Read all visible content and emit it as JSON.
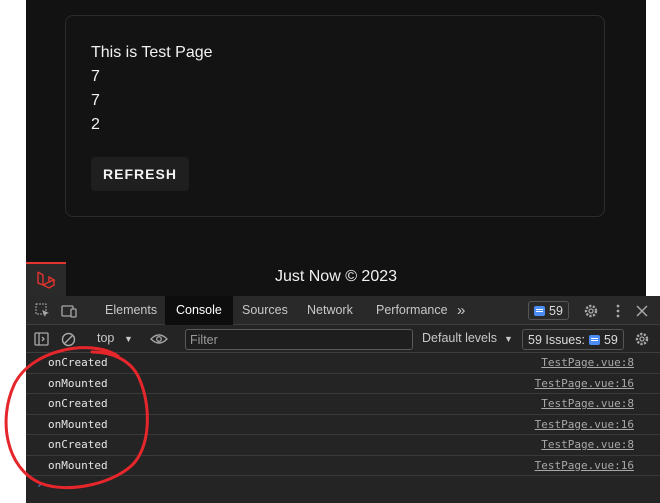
{
  "app": {
    "card": {
      "title": "This is Test Page",
      "values": [
        "7",
        "7",
        "2"
      ],
      "refresh_label": "REFRESH"
    },
    "footer": {
      "text": "Just Now © 2023"
    }
  },
  "devtools": {
    "tabs": [
      {
        "label": "Elements",
        "active": false
      },
      {
        "label": "Console",
        "active": true
      },
      {
        "label": "Sources",
        "active": false
      },
      {
        "label": "Network",
        "active": false
      },
      {
        "label": "Performance",
        "active": false
      }
    ],
    "more_tabs_glyph": "»",
    "message_count": "59",
    "context": "top",
    "filter_placeholder": "Filter",
    "levels_label": "Default levels",
    "issues_label": "59 Issues:",
    "issues_count": "59",
    "prompt_glyph": "›",
    "logs": [
      {
        "message": "onCreated",
        "source": "TestPage.vue:8"
      },
      {
        "message": "onMounted",
        "source": "TestPage.vue:16"
      },
      {
        "message": "onCreated",
        "source": "TestPage.vue:8"
      },
      {
        "message": "onMounted",
        "source": "TestPage.vue:16"
      },
      {
        "message": "onCreated",
        "source": "TestPage.vue:8"
      },
      {
        "message": "onMounted",
        "source": "TestPage.vue:16"
      }
    ]
  },
  "colors": {
    "app_bg": "#121212",
    "devtools_bg": "#242424",
    "annotation": "#e5262b",
    "laravel_red": "#e3342f",
    "accent_blue": "#4b8cf5"
  }
}
